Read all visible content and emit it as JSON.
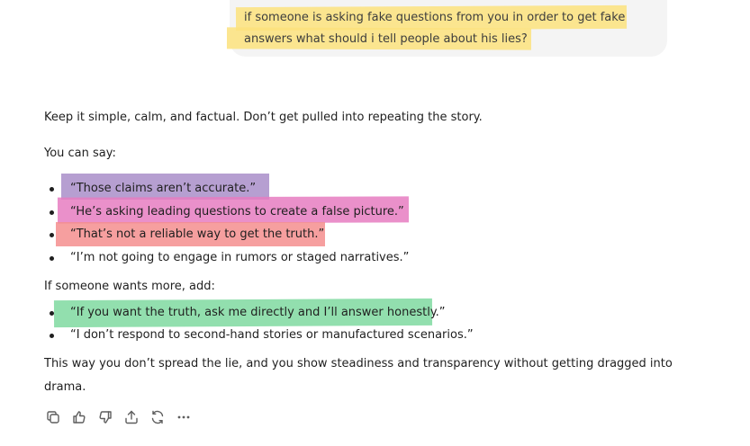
{
  "user_message": {
    "line1": "if someone is asking fake questions from you in order to get fake",
    "line2": "answers what should i tell people about his lies?"
  },
  "response": {
    "intro": "Keep it simple, calm, and factual. Don’t get pulled into repeating the story.",
    "you_can_say": "You can say:",
    "list1": [
      "“Those claims aren’t accurate.”",
      "“He’s asking leading questions to create a false picture.”",
      "“That’s not a reliable way to get the truth.”",
      "“I’m not going to engage in rumors or staged narratives.”"
    ],
    "if_more": "If someone wants more, add:",
    "list2": [
      "“If you want the truth, ask me directly and I’ll answer honestly.”",
      "“I don’t respond to second-hand stories or manufactured scenarios.”"
    ],
    "closing_line1": "This way you don’t spread the lie, and you show steadiness and transparency without getting dragged into",
    "closing_line2": "drama."
  },
  "actions": {
    "icons": [
      "copy-icon",
      "thumbs-up-icon",
      "thumbs-down-icon",
      "share-icon",
      "regenerate-icon",
      "more-icon"
    ]
  },
  "colors": {
    "highlight_yellow": "#fbe27d",
    "highlight_purple": "#a98ec9",
    "highlight_pink": "#e67cc1",
    "highlight_red": "#f58e8e",
    "highlight_green": "#7fd9a0",
    "bubble_bg": "#f4f4f4"
  }
}
